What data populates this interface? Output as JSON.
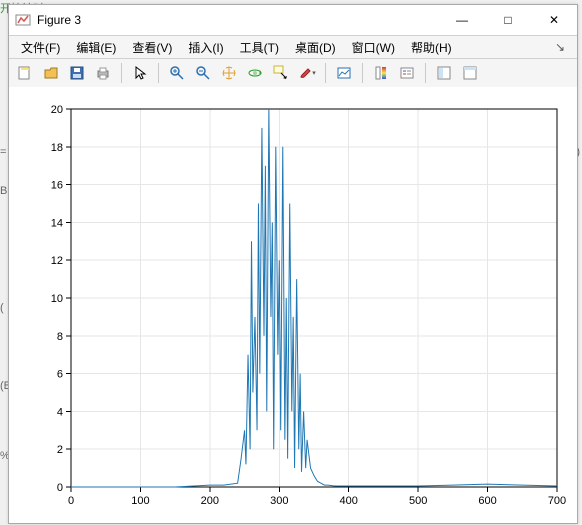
{
  "window": {
    "title": "Figure 3",
    "icon_name": "matlab-figure-icon"
  },
  "window_controls": {
    "minimize": "—",
    "maximize": "□",
    "close": "✕"
  },
  "menu": {
    "file": "文件(F)",
    "edit": "编辑(E)",
    "view": "查看(V)",
    "insert": "插入(I)",
    "tools": "工具(T)",
    "desktop": "桌面(D)",
    "window": "窗口(W)",
    "help": "帮助(H)",
    "corner_glyph": "↘"
  },
  "toolbar": {
    "new_figure": "new-figure-icon",
    "open": "open-icon",
    "save": "save-icon",
    "print": "print-icon",
    "pointer": "pointer-icon",
    "zoom_in": "zoom-in-icon",
    "zoom_out": "zoom-out-icon",
    "pan": "pan-icon",
    "rotate3d": "rotate3d-icon",
    "data_cursor": "data-cursor-icon",
    "brush": "brush-icon",
    "link": "link-plot-icon",
    "colorbar": "colorbar-icon",
    "legend": "legend-icon",
    "hide_tools": "hide-tools-icon",
    "dock": "dock-icon"
  },
  "chart_data": {
    "type": "line",
    "title": "",
    "xlabel": "",
    "ylabel": "",
    "xlim": [
      0,
      700
    ],
    "ylim": [
      0,
      20
    ],
    "xticks": [
      0,
      100,
      200,
      300,
      400,
      500,
      600,
      700
    ],
    "yticks": [
      0,
      2,
      4,
      6,
      8,
      10,
      12,
      14,
      16,
      18,
      20
    ],
    "x": [
      0,
      50,
      100,
      150,
      200,
      220,
      240,
      245,
      250,
      252,
      255,
      258,
      260,
      262,
      265,
      268,
      270,
      272,
      275,
      278,
      280,
      282,
      285,
      288,
      290,
      292,
      295,
      298,
      300,
      302,
      305,
      308,
      310,
      312,
      315,
      318,
      320,
      322,
      325,
      328,
      330,
      332,
      335,
      338,
      340,
      345,
      350,
      355,
      360,
      365,
      370,
      380,
      400,
      450,
      500,
      550,
      600,
      650,
      700
    ],
    "values": [
      0,
      0,
      0,
      0,
      0.1,
      0.1,
      0.2,
      1.5,
      3.0,
      1.2,
      7.0,
      2.0,
      13.0,
      5.0,
      9.0,
      3.0,
      15.0,
      6.0,
      19.0,
      8.0,
      17.0,
      4.0,
      20.0,
      9.0,
      14.0,
      2.0,
      18.0,
      7.0,
      12.0,
      3.0,
      18.0,
      2.5,
      10.0,
      1.5,
      15.0,
      4.0,
      9.0,
      1.0,
      11.0,
      2.0,
      6.0,
      0.8,
      4.0,
      1.0,
      2.5,
      1.0,
      0.6,
      0.3,
      0.2,
      0.1,
      0.1,
      0.05,
      0.05,
      0.05,
      0.05,
      0.1,
      0.15,
      0.1,
      0.05
    ],
    "series_color": "#1f77b4"
  },
  "side_clutter": {
    "top": "开始计时",
    "eq1": "=",
    "b1": "B",
    "b2": "(B",
    "pct": "%)"
  }
}
